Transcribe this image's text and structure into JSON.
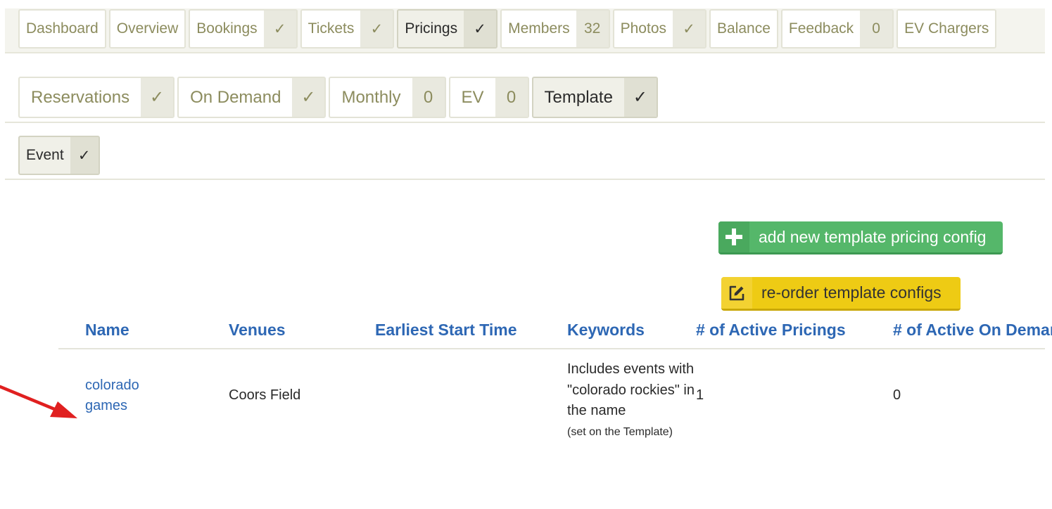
{
  "nav_tabs": [
    {
      "label": "Dashboard",
      "count": ""
    },
    {
      "label": "Overview",
      "count": ""
    },
    {
      "label": "Bookings",
      "count": "✓"
    },
    {
      "label": "Tickets",
      "count": "✓"
    },
    {
      "label": "Pricings",
      "count": "✓",
      "active": true
    },
    {
      "label": "Members",
      "count": "32"
    },
    {
      "label": "Photos",
      "count": "✓"
    },
    {
      "label": "Balance",
      "count": ""
    },
    {
      "label": "Feedback",
      "count": "0"
    },
    {
      "label": "EV Chargers",
      "count": ""
    }
  ],
  "pricing_tabs": [
    {
      "label": "Reservations",
      "count": "✓"
    },
    {
      "label": "On Demand",
      "count": "✓"
    },
    {
      "label": "Monthly",
      "count": "0"
    },
    {
      "label": "EV",
      "count": "0"
    },
    {
      "label": "Template",
      "count": "✓",
      "active": true
    }
  ],
  "template_tabs": [
    {
      "label": "Event",
      "count": "✓",
      "active": true
    }
  ],
  "actions": {
    "add_label": "add new template pricing config",
    "reorder_label": "re-order template configs"
  },
  "table": {
    "headers": [
      "Name",
      "Venues",
      "Earliest Start Time",
      "Keywords",
      "# of Active Pricings",
      "# of Active On Demand"
    ],
    "rows": [
      {
        "name": "colorado games",
        "venues": "Coors Field",
        "earliest_start": "",
        "keywords": "Includes events with \"colorado rockies\" in the name",
        "keywords_note": "(set on the Template)",
        "active_pricings": "1",
        "active_on_demand": "0"
      }
    ]
  },
  "colors": {
    "accent_blue": "#2d67b4",
    "tab_text": "#8c8c5e",
    "button_green": "#55b76a",
    "button_yellow": "#eecb14",
    "annotation_arrow": "#e02020"
  },
  "icons": {
    "add": "plus-icon",
    "reorder": "edit-icon",
    "annotation": "red-arrow-icon"
  }
}
